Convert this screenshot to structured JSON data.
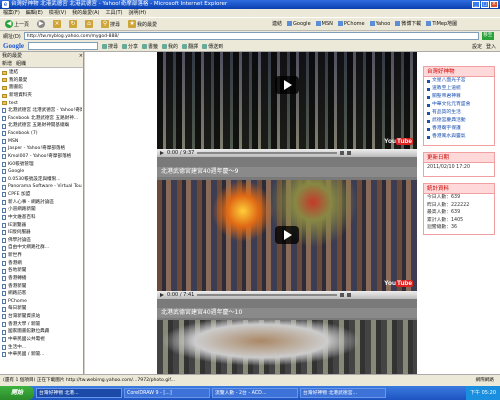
{
  "window": {
    "title": "台灣好神物 北港武德宮 北港武德宮 - Yahoo!奇摩部落格 - Microsoft Internet Explorer",
    "buttons": [
      "_",
      "□",
      "×"
    ]
  },
  "menu": [
    "檔案(F)",
    "編輯(E)",
    "檢視(V)",
    "我的最愛(A)",
    "工具(T)",
    "說明(H)"
  ],
  "toolbar": {
    "back": "上一頁",
    "forward": "",
    "search": "搜尋",
    "favorites": "我的最愛",
    "links_label": "連結",
    "links": [
      "Google",
      "MSN",
      "PChome",
      "Yahoo",
      "微博下載",
      "TiMep地圖"
    ]
  },
  "address": {
    "label": "網址(D)",
    "url": "http://tw.myblog.yahoo.com/mygod-888/",
    "go": "移至"
  },
  "google_bar": {
    "logo": "Google",
    "items": [
      "搜尋",
      "分享",
      "書籤",
      "我的",
      "翻譯",
      "傳送到"
    ],
    "right": [
      "設定",
      "登入"
    ]
  },
  "sidebar": {
    "title": "我的最愛",
    "close": "×",
    "tools": [
      "新增",
      "組織"
    ],
    "items": [
      "連結",
      "我的最愛",
      "圖書館",
      "新增資料夾",
      "test",
      "北港武德宮 北港武德宮 - Yahoo!奇摩...",
      "Facebook 北港武德宮 五路財神...",
      "北港武德宮 五路財神開基總廟",
      "Facebook (7)",
      "MSN",
      "Jasper - Yahoo!奇摩部落格",
      "Kmol007 - Yahoo!奇摩部落格",
      "Ki0帳號管理",
      "Google",
      "0.0530帳號設定與權限...",
      "Panorama Software - Virtual Tour...",
      "CPFE 加盟",
      "新人心事 - 網路討論區",
      "小道網路新聞",
      "中文維基百科",
      "IE瀏覽器",
      "IE版伺服器",
      "佛學討論區",
      "自由中文網路社群...",
      "新世界",
      "香港網",
      "各地新聞",
      "香港轉播",
      "香港新聞",
      "網路訪客",
      "PChome",
      "每日新聞",
      "台灣新聞資訊站",
      "香港大學 / 新聞",
      "國家圖書館數位典藏",
      "中華民國公共電視",
      "生活中...",
      "中華民國 / 新聞..."
    ]
  },
  "videos": [
    {
      "time": "0:00 / 9:37",
      "title": ""
    },
    {
      "time": "0:00 / 7:41",
      "title": "北港武德宮建宮40週年慶～9"
    },
    {
      "time": "",
      "title": "北港武德宮建宮40週年慶～10"
    }
  ],
  "youtube": {
    "you": "You",
    "tube": "Tube"
  },
  "right_panel": {
    "links_title": "台灣好神物",
    "links": [
      "文星八面光子宮",
      "道教至上道統",
      "關聖帝君神尊",
      "中華文化元宵盛會",
      "有品質的生活",
      "武德宮慶典活動",
      "香港廟宇保護",
      "香港風水與靈氣"
    ],
    "update_title": "更新日期",
    "update_value": "2011/02/10 17:20",
    "stats_title": "統計資料",
    "stats": [
      "今日人數：639",
      "昨日人數：222222",
      "最高人數：639",
      "累計人數：1405",
      "迴響總數：36"
    ]
  },
  "status": {
    "text": "(還有 1 個項目) 正在下載圖片 http://tw.webimg.yahoo.com/...7972/photo.gif...",
    "zone": "網際網路"
  },
  "taskbar": {
    "start": "開始",
    "tasks": [
      "台灣好神物 北港...",
      "CorelDRAW 9 - [...]",
      "流覽人數 - 2台 - ACD...",
      "台灣好神物 北港武德宮..."
    ],
    "tray": "下午 05:20"
  }
}
